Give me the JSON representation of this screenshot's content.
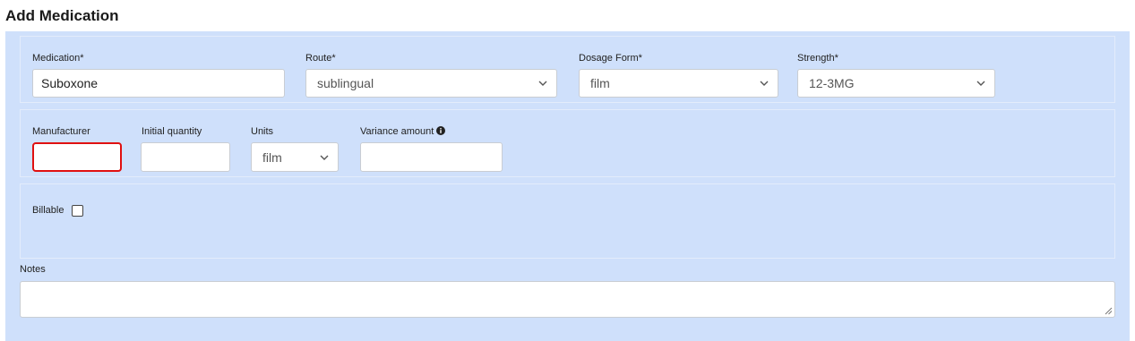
{
  "page": {
    "title": "Add Medication"
  },
  "medication": {
    "label": "Medication*",
    "value": "Suboxone"
  },
  "route": {
    "label": "Route*",
    "value": "sublingual"
  },
  "dosage_form": {
    "label": "Dosage Form*",
    "value": "film"
  },
  "strength": {
    "label": "Strength*",
    "value": "12-3MG"
  },
  "manufacturer": {
    "label": "Manufacturer",
    "value": ""
  },
  "initial_quantity": {
    "label": "Initial quantity",
    "value": ""
  },
  "units": {
    "label": "Units",
    "value": "film"
  },
  "variance_amount": {
    "label": "Variance amount",
    "value": ""
  },
  "billable": {
    "label": "Billable",
    "checked": false
  },
  "notes": {
    "label": "Notes",
    "value": ""
  },
  "icons": {
    "select_chevron": "chevron-down-icon",
    "variance_info": "info-circle-icon",
    "notes_resize": "resize-grip-icon"
  },
  "colors": {
    "panel_bg": "#cfe0fb",
    "focus_border": "#e01010"
  }
}
